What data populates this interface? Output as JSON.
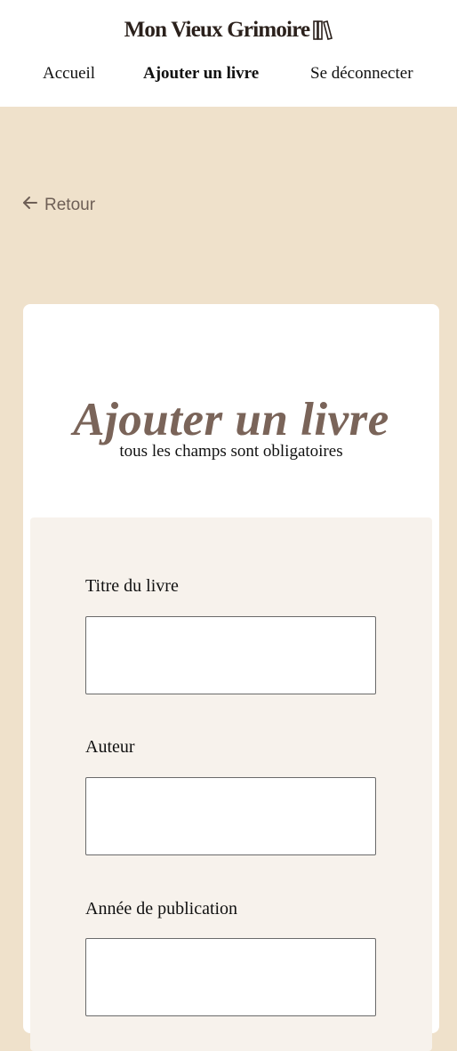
{
  "header": {
    "logo_text": "Mon Vieux Grimoire",
    "logo_icon": "books-icon",
    "nav": [
      {
        "label": "Accueil"
      },
      {
        "label": "Ajouter un livre"
      },
      {
        "label": "Se déconnecter"
      }
    ]
  },
  "back_link": {
    "label": "Retour",
    "icon": "arrow-left-icon"
  },
  "card": {
    "title": "Ajouter un livre",
    "subtitle": "tous les champs sont obligatoires"
  },
  "form": {
    "fields": [
      {
        "label": "Titre du livre",
        "value": ""
      },
      {
        "label": "Auteur",
        "value": ""
      },
      {
        "label": "Année de publication",
        "value": ""
      }
    ]
  },
  "colors": {
    "background": "#efe1cb",
    "title": "#7a6459",
    "form_bg": "#f7f2ec"
  }
}
